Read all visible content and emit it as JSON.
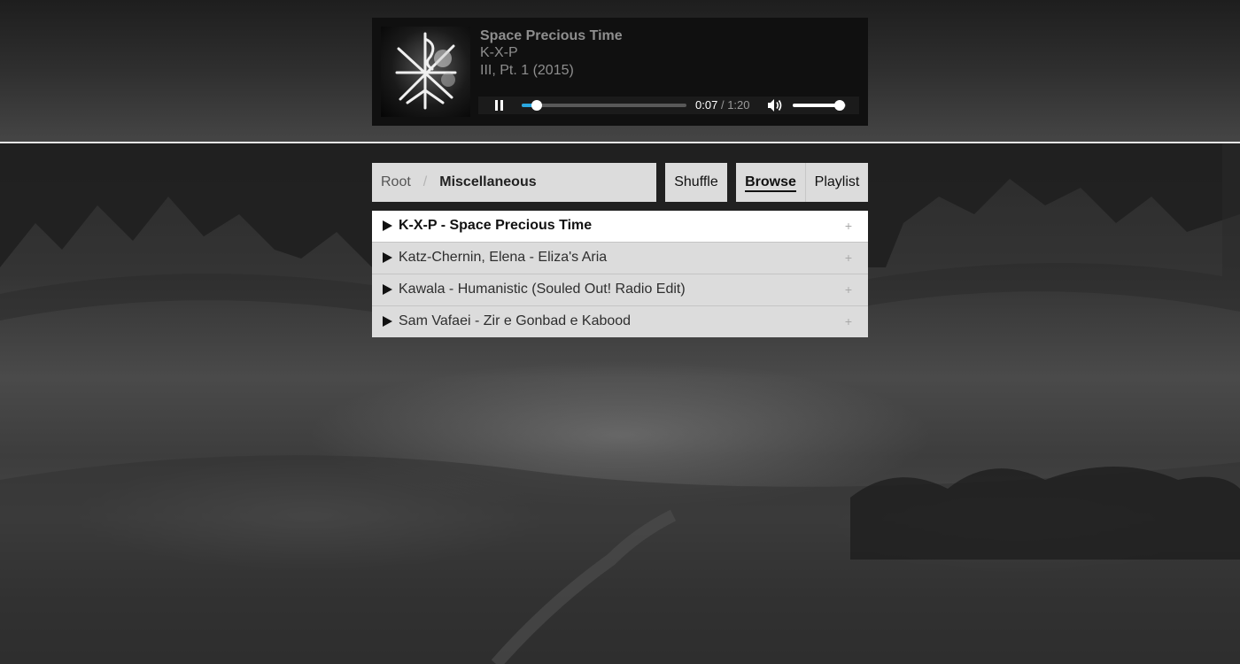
{
  "player": {
    "title": "Space Precious Time",
    "artist": "K-X-P",
    "album": "III, Pt. 1 (2015)",
    "elapsed": "0:07",
    "separator": "/",
    "duration": "1:20",
    "progress_fraction": 0.09,
    "volume_fraction": 0.88,
    "state": "playing",
    "accent_color": "#2aa7e0"
  },
  "breadcrumb": {
    "root": "Root",
    "separator": "/",
    "current": "Miscellaneous"
  },
  "nav": {
    "shuffle": "Shuffle",
    "browse": "Browse",
    "playlist": "Playlist",
    "active": "browse"
  },
  "tracks": [
    {
      "label": "K-X-P - Space Precious Time",
      "add": "+",
      "active": true
    },
    {
      "label": "Katz-Chernin, Elena - Eliza's Aria",
      "add": "+",
      "active": false
    },
    {
      "label": "Kawala - Humanistic (Souled Out! Radio Edit)",
      "add": "+",
      "active": false
    },
    {
      "label": "Sam Vafaei - Zir e Gonbad e Kabood",
      "add": "+",
      "active": false
    }
  ],
  "icons": {
    "cover": "album-cover-image",
    "pause": "pause-icon",
    "volume": "volume-icon",
    "play": "play-icon",
    "add": "plus-icon"
  }
}
